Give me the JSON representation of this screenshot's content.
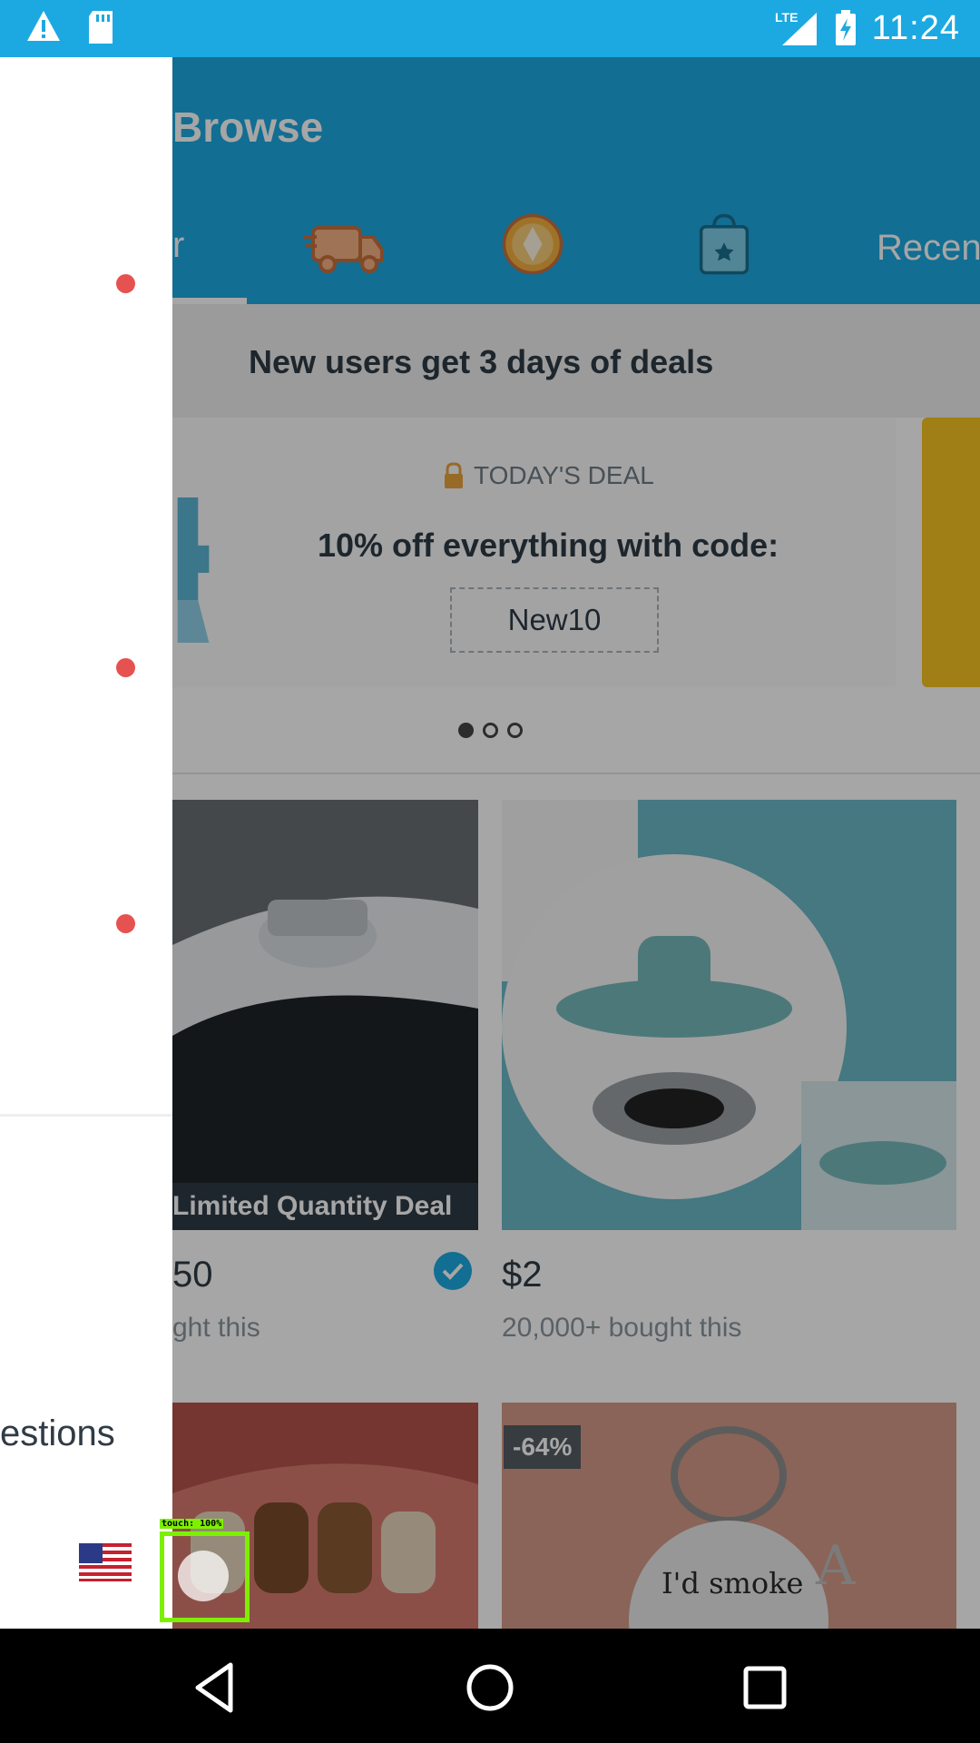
{
  "status_bar": {
    "time": "11:24",
    "network": "LTE",
    "icons": [
      "warning-icon",
      "sd-card-icon",
      "signal-icon",
      "battery-charging-icon"
    ]
  },
  "app": {
    "title": "Browse",
    "tabs": [
      {
        "label": "r",
        "icon": "partial-tab"
      },
      {
        "label": "",
        "icon": "truck-icon"
      },
      {
        "label": "",
        "icon": "gem-icon"
      },
      {
        "label": "",
        "icon": "shopping-bag-star-icon"
      },
      {
        "label": "Recen",
        "icon": "partial-tab"
      }
    ],
    "promo_banner": "New users get 3 days of deals",
    "deal": {
      "header": "TODAY'S DEAL",
      "title": "10% off everything with code:",
      "code": "New10"
    },
    "carousel": {
      "pages": 3,
      "active": 1
    },
    "products": [
      {
        "price": "50",
        "bought": "ght this",
        "banner": "Limited Quantity Deal",
        "verified": true
      },
      {
        "price": "$2",
        "bought": "20,000+ bought this"
      },
      {
        "discount": ""
      },
      {
        "discount": "-64%"
      }
    ]
  },
  "drawer": {
    "questions_text": "estions",
    "flag": "us-flag-icon"
  },
  "touch_indicator": {
    "label": "touch: 100%"
  },
  "nav_bar": {
    "buttons": [
      "back-icon",
      "home-icon",
      "recents-icon"
    ]
  }
}
